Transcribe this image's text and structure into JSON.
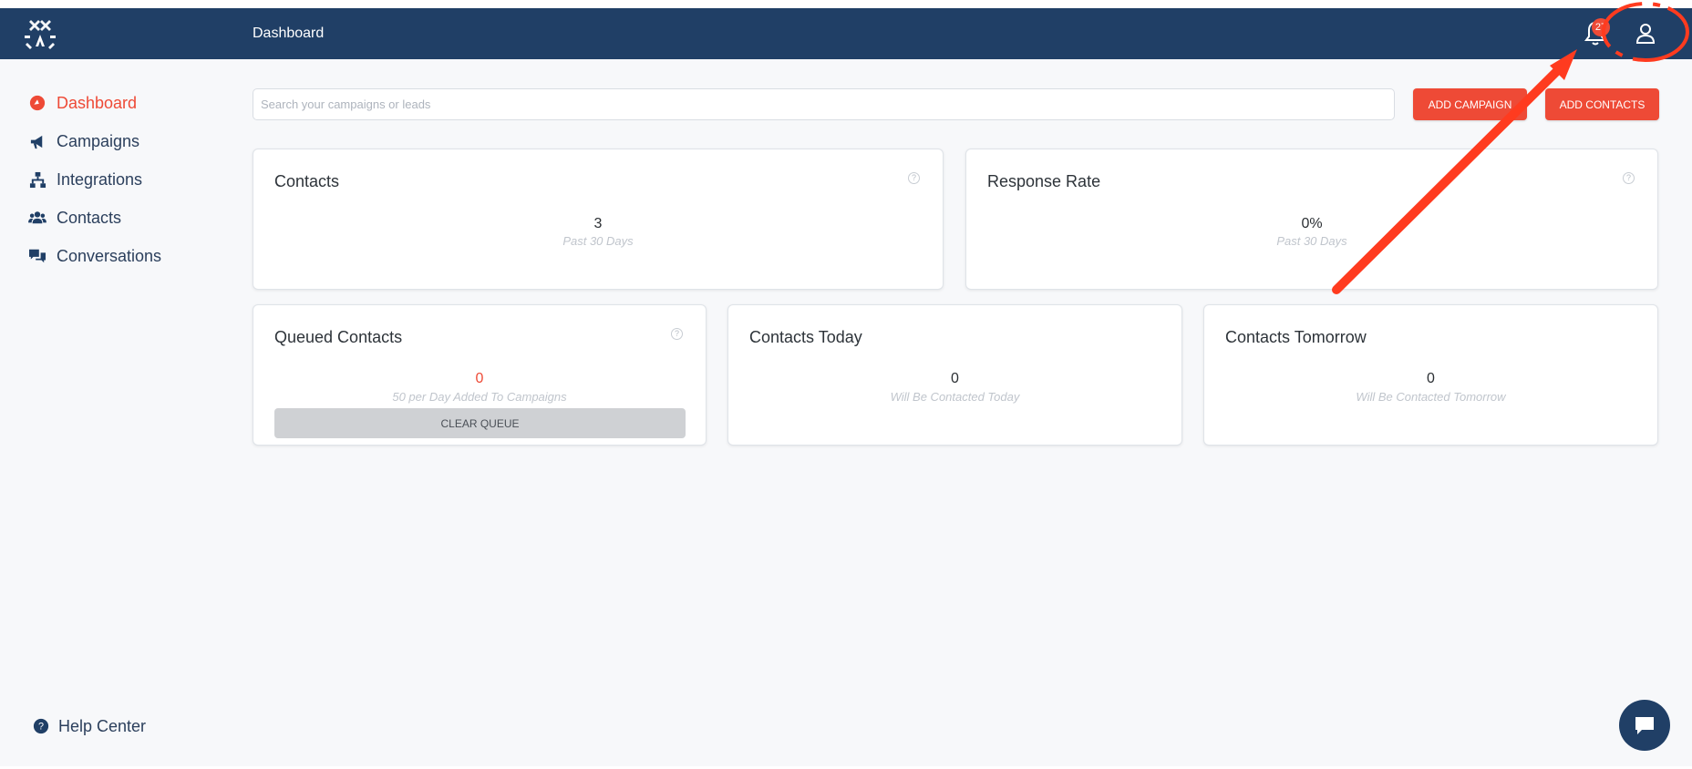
{
  "header": {
    "title": "Dashboard",
    "notification_count": "27",
    "icons": [
      "logo-icon",
      "bell-icon",
      "user-icon"
    ]
  },
  "sidebar": {
    "items": [
      {
        "label": "Dashboard",
        "icon": "dashboard-icon",
        "active": true
      },
      {
        "label": "Campaigns",
        "icon": "megaphone-icon",
        "active": false
      },
      {
        "label": "Integrations",
        "icon": "network-icon",
        "active": false
      },
      {
        "label": "Contacts",
        "icon": "users-icon",
        "active": false
      },
      {
        "label": "Conversations",
        "icon": "chat-bubbles-icon",
        "active": false
      }
    ],
    "help_label": "Help Center"
  },
  "toolbar": {
    "search_placeholder": "Search your campaigns or leads",
    "add_campaign_label": "ADD CAMPAIGN",
    "add_contacts_label": "ADD CONTACTS"
  },
  "cards": {
    "contacts": {
      "title": "Contacts",
      "value": "3",
      "subtitle": "Past 30 Days"
    },
    "response_rate": {
      "title": "Response Rate",
      "value": "0%",
      "subtitle": "Past 30 Days"
    },
    "queued": {
      "title": "Queued Contacts",
      "value": "0",
      "subtitle": "50 per Day Added To Campaigns",
      "button_label": "CLEAR QUEUE"
    },
    "today": {
      "title": "Contacts Today",
      "value": "0",
      "subtitle": "Will Be Contacted Today"
    },
    "tomorrow": {
      "title": "Contacts Tomorrow",
      "value": "0",
      "subtitle": "Will Be Contacted Tomorrow"
    }
  },
  "colors": {
    "header": "#203f66",
    "accent": "#ee4a36",
    "annotation": "#ff3b1f",
    "background": "#f7f8fa"
  }
}
